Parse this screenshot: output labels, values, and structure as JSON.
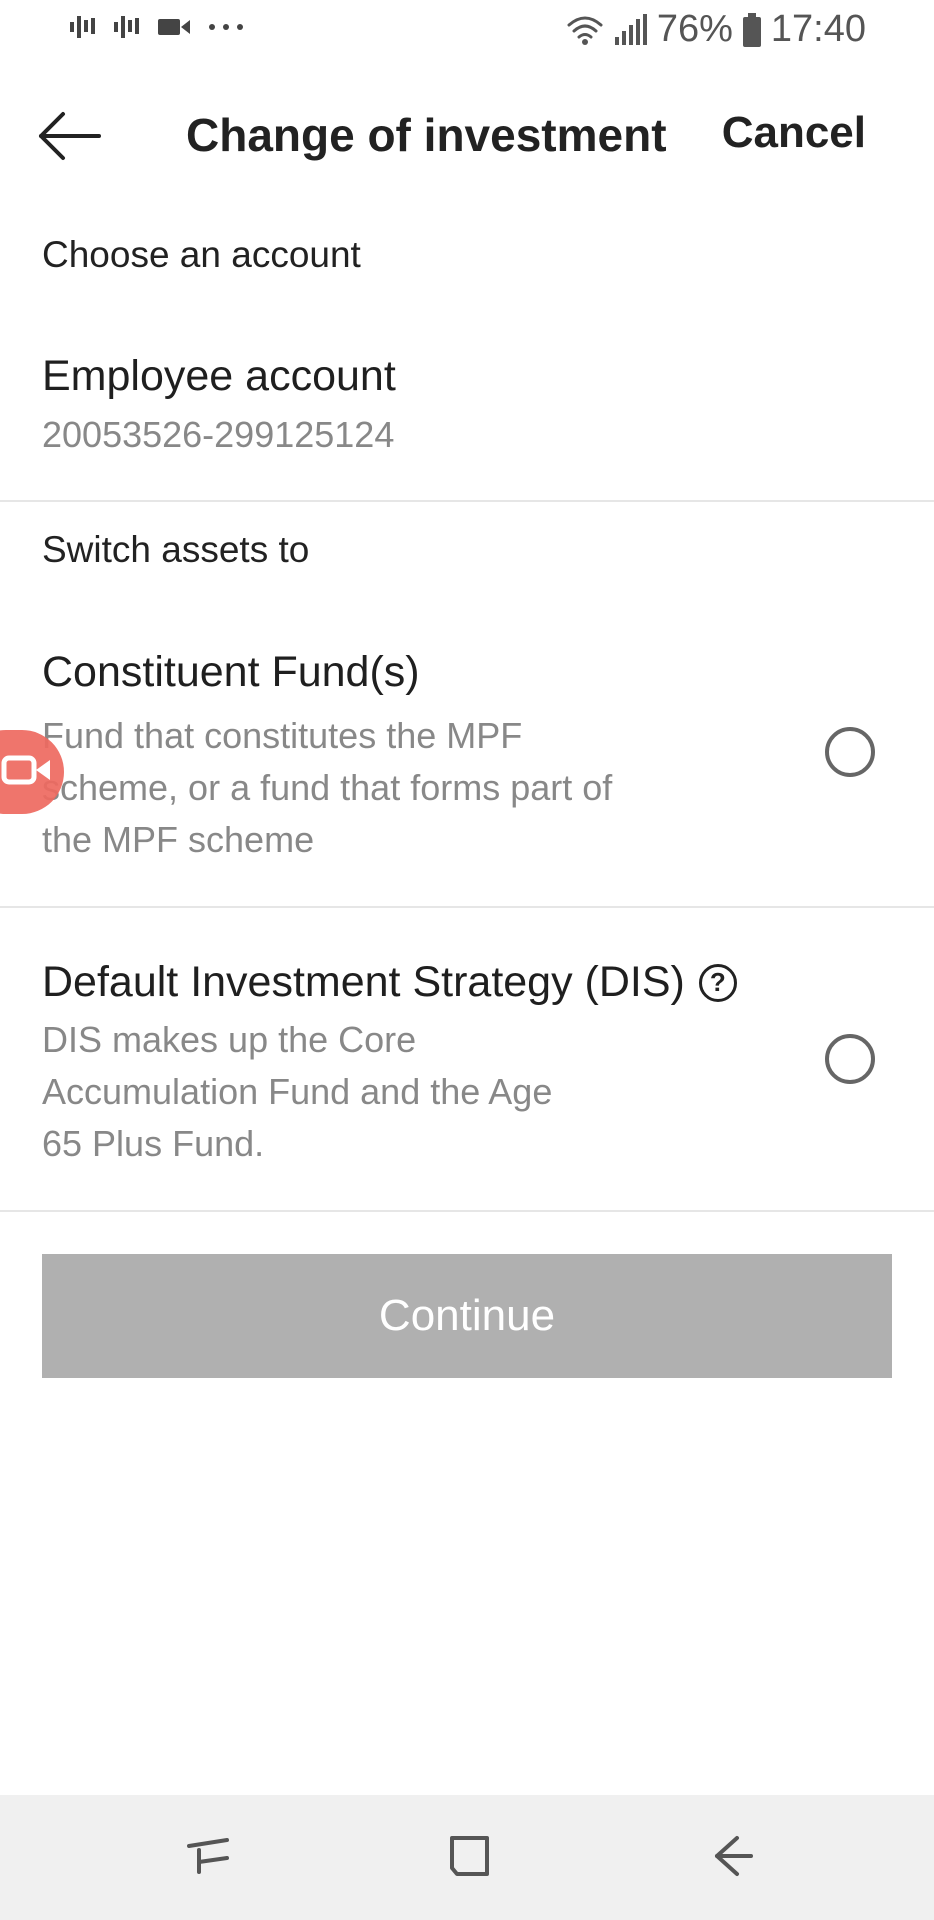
{
  "status_bar": {
    "left_icons": [
      "signal-bars-icon",
      "signal-bars-icon",
      "video-camera-icon",
      "more-dots-icon"
    ],
    "battery": "76%",
    "time": "17:40"
  },
  "app_bar": {
    "title": "Change of investment",
    "cancel_label": "Cancel"
  },
  "account_section": {
    "label": "Choose an account",
    "account_name": "Employee account",
    "account_number": "20053526-299125124"
  },
  "switch_section": {
    "label": "Switch assets to",
    "options": [
      {
        "title": "Constituent Fund(s)",
        "description": "Fund that constitutes the MPF scheme, or a fund that forms part of the MPF scheme",
        "selected": false
      },
      {
        "title": "Default Investment Strategy (DIS)",
        "help_icon_glyph": "?",
        "description": "DIS makes up the Core Accumulation Fund and the Age 65 Plus Fund.",
        "selected": false
      }
    ]
  },
  "continue_label": "Continue",
  "colors": {
    "continue_disabled_bg": "#b0b0b0",
    "record_bubble": "#ee6a60",
    "nav_bar_bg": "#f0f0f0"
  }
}
